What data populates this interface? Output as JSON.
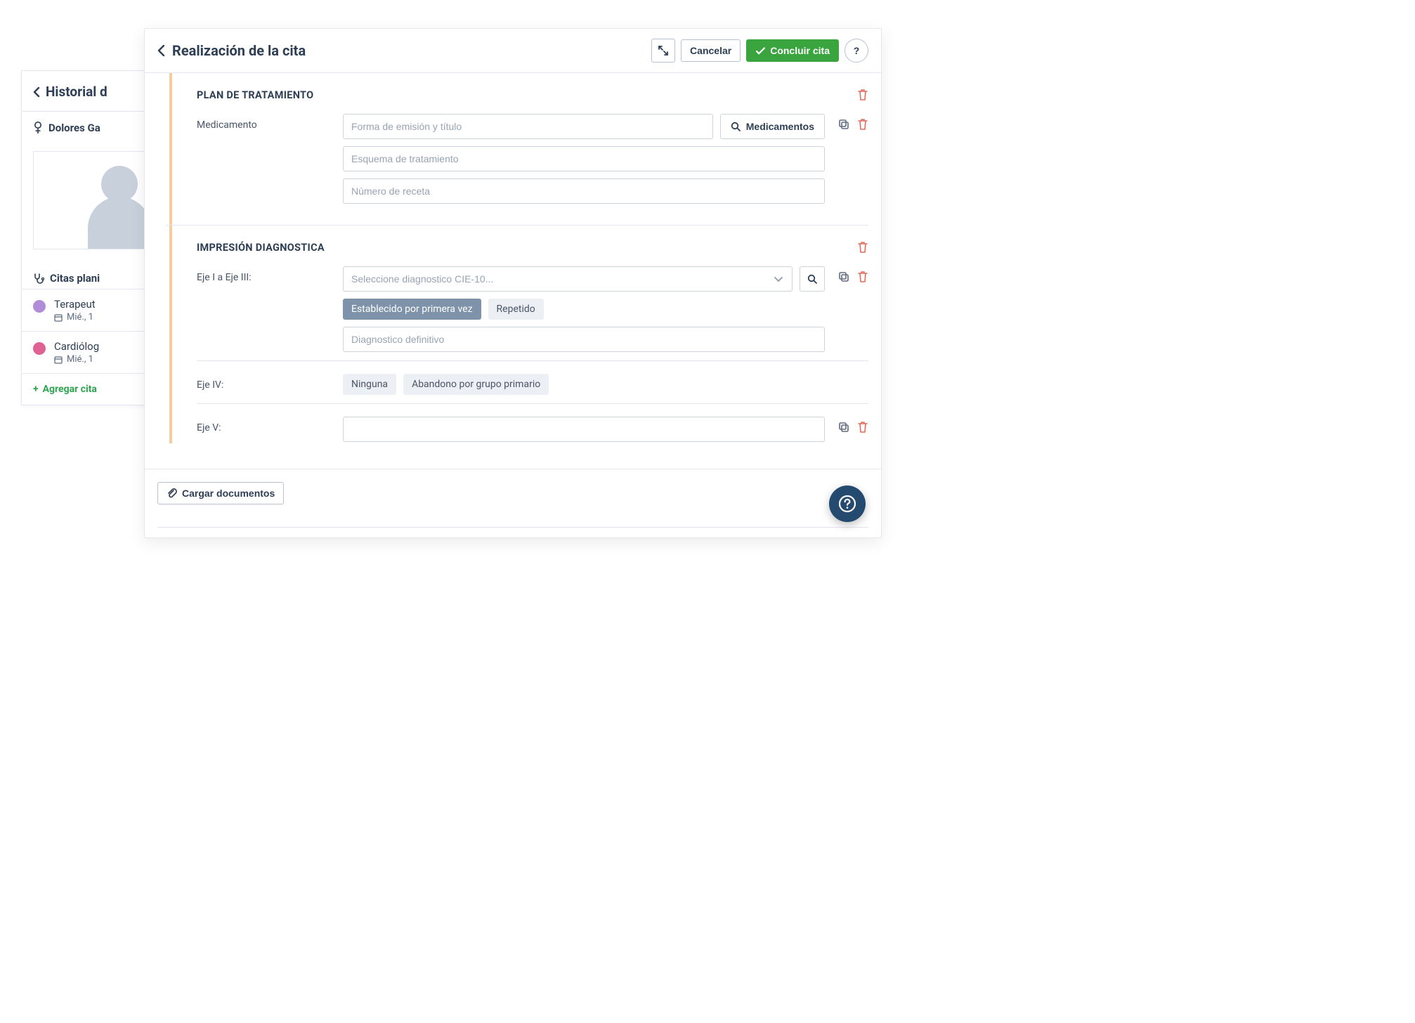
{
  "back": {
    "title": "Historial d",
    "patient_name": "Dolores Ga",
    "appointments_title": "Citas plani",
    "appointments": [
      {
        "title": "Terapeut",
        "meta": "Mié., 1"
      },
      {
        "title": "Cardiólog",
        "meta": "Mié., 1"
      }
    ],
    "add_label": "Agregar cita"
  },
  "front": {
    "title": "Realización de la cita",
    "actions": {
      "cancel": "Cancelar",
      "conclude": "Concluir cita"
    },
    "treatment": {
      "heading": "PLAN DE TRATAMIENTO",
      "med_label": "Medicamento",
      "ph_form_title": "Forma de emisión y título",
      "btn_medications": "Medicamentos",
      "ph_scheme": "Esquema de tratamiento",
      "ph_rx_number": "Número de receta"
    },
    "diagnosis": {
      "heading": "IMPRESIÓN DIAGNOSTICA",
      "eje13_label": "Eje I a Eje III:",
      "ph_cie10": "Seleccione diagnostico CIE-10...",
      "pill_first": "Establecido por primera vez",
      "pill_repeat": "Repetido",
      "ph_definitive": "Diagnostico definitivo",
      "eje4_label": "Eje IV:",
      "eje4_pill_none": "Ninguna",
      "eje4_pill_abandon": "Abandono por grupo primario",
      "eje5_label": "Eje V:"
    },
    "footer": {
      "upload_docs": "Cargar documentos"
    }
  }
}
